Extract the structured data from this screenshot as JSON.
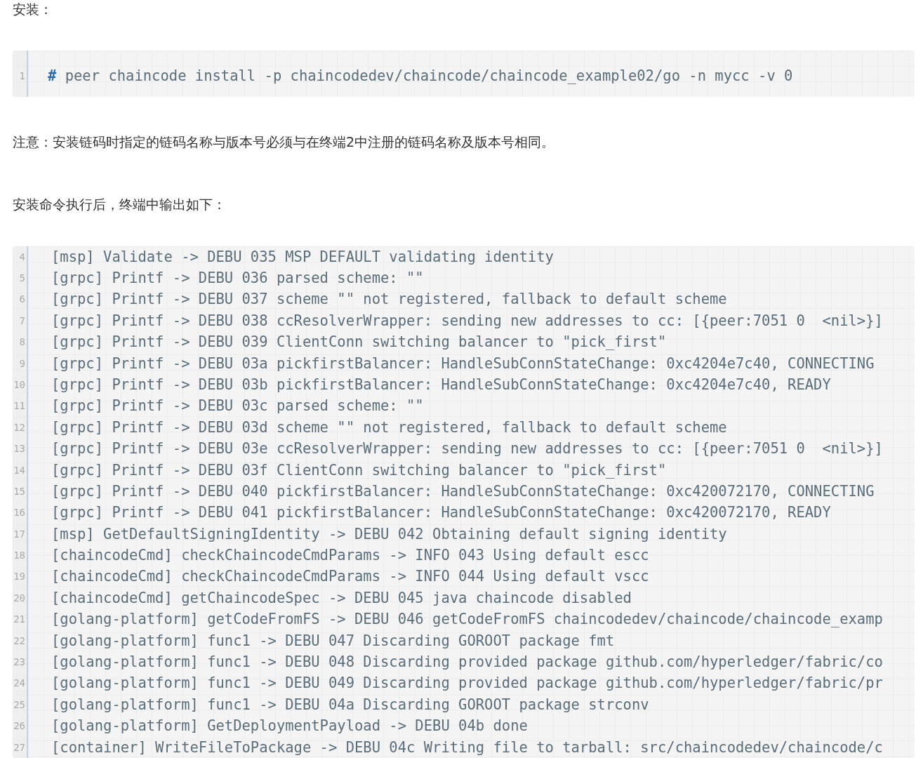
{
  "heading": "安装：",
  "install_block": {
    "lines": [
      {
        "number": "1",
        "prompt": "#",
        "code": "peer chaincode install -p chaincodedev/chaincode/chaincode_example02/go -n mycc -v 0"
      }
    ]
  },
  "note": "注意：安装链码时指定的链码名称与版本号必须与在终端2中注册的链码名称及版本号相同。",
  "output_intro": "安装命令执行后，终端中输出如下：",
  "output_block": {
    "lines": [
      {
        "number": "4",
        "code": "[msp] Validate -> DEBU 035 MSP DEFAULT validating identity"
      },
      {
        "number": "5",
        "code": "[grpc] Printf -> DEBU 036 parsed scheme: \"\""
      },
      {
        "number": "6",
        "code": "[grpc] Printf -> DEBU 037 scheme \"\" not registered, fallback to default scheme"
      },
      {
        "number": "7",
        "code": "[grpc] Printf -> DEBU 038 ccResolverWrapper: sending new addresses to cc: [{peer:7051 0  <nil>}]"
      },
      {
        "number": "8",
        "code": "[grpc] Printf -> DEBU 039 ClientConn switching balancer to \"pick_first\""
      },
      {
        "number": "9",
        "code": "[grpc] Printf -> DEBU 03a pickfirstBalancer: HandleSubConnStateChange: 0xc4204e7c40, CONNECTING"
      },
      {
        "number": "10",
        "code": "[grpc] Printf -> DEBU 03b pickfirstBalancer: HandleSubConnStateChange: 0xc4204e7c40, READY"
      },
      {
        "number": "11",
        "code": "[grpc] Printf -> DEBU 03c parsed scheme: \"\""
      },
      {
        "number": "12",
        "code": "[grpc] Printf -> DEBU 03d scheme \"\" not registered, fallback to default scheme"
      },
      {
        "number": "13",
        "code": "[grpc] Printf -> DEBU 03e ccResolverWrapper: sending new addresses to cc: [{peer:7051 0  <nil>}]"
      },
      {
        "number": "14",
        "code": "[grpc] Printf -> DEBU 03f ClientConn switching balancer to \"pick_first\""
      },
      {
        "number": "15",
        "code": "[grpc] Printf -> DEBU 040 pickfirstBalancer: HandleSubConnStateChange: 0xc420072170, CONNECTING"
      },
      {
        "number": "16",
        "code": "[grpc] Printf -> DEBU 041 pickfirstBalancer: HandleSubConnStateChange: 0xc420072170, READY"
      },
      {
        "number": "17",
        "code": "[msp] GetDefaultSigningIdentity -> DEBU 042 Obtaining default signing identity"
      },
      {
        "number": "18",
        "code": "[chaincodeCmd] checkChaincodeCmdParams -> INFO 043 Using default escc"
      },
      {
        "number": "19",
        "code": "[chaincodeCmd] checkChaincodeCmdParams -> INFO 044 Using default vscc"
      },
      {
        "number": "20",
        "code": "[chaincodeCmd] getChaincodeSpec -> DEBU 045 java chaincode disabled"
      },
      {
        "number": "21",
        "code": "[golang-platform] getCodeFromFS -> DEBU 046 getCodeFromFS chaincodedev/chaincode/chaincode_examp"
      },
      {
        "number": "22",
        "code": "[golang-platform] func1 -> DEBU 047 Discarding GOROOT package fmt"
      },
      {
        "number": "23",
        "code": "[golang-platform] func1 -> DEBU 048 Discarding provided package github.com/hyperledger/fabric/co"
      },
      {
        "number": "24",
        "code": "[golang-platform] func1 -> DEBU 049 Discarding provided package github.com/hyperledger/fabric/pr"
      },
      {
        "number": "25",
        "code": "[golang-platform] func1 -> DEBU 04a Discarding GOROOT package strconv"
      },
      {
        "number": "26",
        "code": "[golang-platform] GetDeploymentPayload -> DEBU 04b done"
      },
      {
        "number": "27",
        "code": "[container] WriteFileToPackage -> DEBU 04c Writing file to tarball: src/chaincodedev/chaincode/c"
      }
    ]
  }
}
